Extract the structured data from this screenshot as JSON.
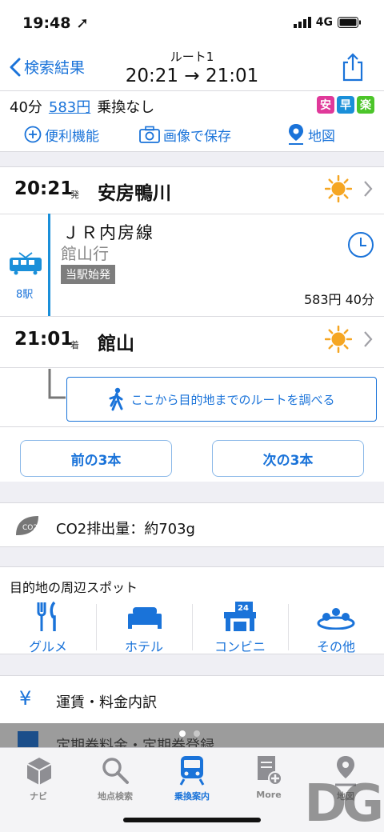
{
  "status": {
    "time": "19:48",
    "network": "4G"
  },
  "nav": {
    "back_label": "検索結果",
    "title": "ルート1",
    "subtitle": "20:21 → 21:01"
  },
  "summary": {
    "duration": "40分",
    "fare": "583円",
    "transfer": "乗換なし",
    "badges": [
      {
        "label": "安",
        "color": "#e0399a"
      },
      {
        "label": "早",
        "color": "#1a8fd9"
      },
      {
        "label": "楽",
        "color": "#4cc52a"
      }
    ],
    "actions": [
      "便利機能",
      "画像で保存",
      "地図"
    ]
  },
  "route": {
    "departure": {
      "time": "20:21",
      "tag": "発",
      "station": "安房鴨川"
    },
    "segment": {
      "line": "ＪＲ内房線",
      "destination": "館山行",
      "tag": "当駅始発",
      "stations": "8駅",
      "fare": "583円",
      "duration": "40分"
    },
    "arrival": {
      "time": "21:01",
      "tag": "着",
      "station": "館山"
    },
    "walk_button": "ここから目的地までのルートを調べる"
  },
  "pager": {
    "prev": "前の3本",
    "next": "次の3本"
  },
  "co2": {
    "label": "CO2排出量：約703g"
  },
  "spots": {
    "title": "目的地の周辺スポット",
    "items": [
      "グルメ",
      "ホテル",
      "コンビニ",
      "その他"
    ]
  },
  "fare_detail": {
    "label": "運賃・料金内訳"
  },
  "partial_row": {
    "label": "定期券料金・定期券登録"
  },
  "tabs": [
    "ナビ",
    "地点検索",
    "乗換案内",
    "More",
    "地図"
  ],
  "colors": {
    "accent": "#1a73d9",
    "tab_active": "#1a73d9",
    "sun": "#f5a623"
  }
}
